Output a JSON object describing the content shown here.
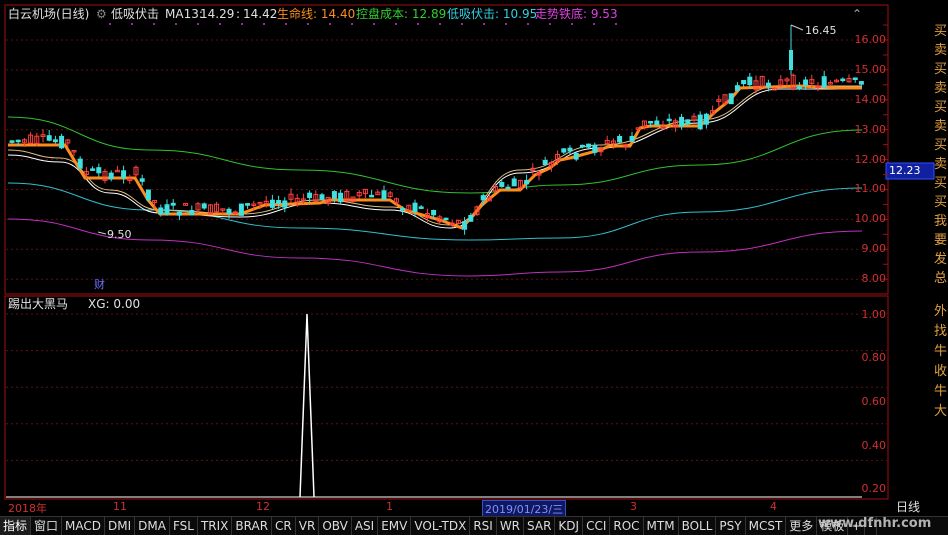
{
  "header": {
    "stock": "白云机场(日线)",
    "indicator_name": "低吸伏击",
    "ma13_label": "MA13:",
    "ma13_a": "14.29",
    "sep": ":",
    "ma13_b": "14.42",
    "life_line": "生命线: 14.40",
    "cost": "控盘成本: 12.89",
    "low_buy": "低吸伏击: 10.95",
    "trend_floor": "走势铁底: 9.53"
  },
  "main_chart": {
    "y_labels": [
      "16.00",
      "15.00",
      "14.00",
      "13.00",
      "12.00",
      "11.00",
      "10.00",
      "9.00",
      "8.00"
    ],
    "current_price": "12.23",
    "high_marker": "16.45",
    "low_marker": "9.50",
    "finance_marker": "财",
    "right_text": [
      "买",
      "卖",
      "买",
      "卖",
      "买",
      "卖",
      "买",
      "卖",
      "买",
      "买",
      "我",
      "要",
      "发",
      "总"
    ]
  },
  "sub_chart": {
    "title": "踢出大黑马",
    "xg": "XG: 0.00",
    "y_labels": [
      "1.00",
      "0.80",
      "0.60",
      "0.40",
      "0.20"
    ],
    "right_text": [
      "外",
      "找",
      "牛",
      "收",
      "牛",
      "大"
    ]
  },
  "date_axis": {
    "labels": [
      "2018年",
      "11",
      "12",
      "1",
      "2019/01/23/三",
      "3",
      "4"
    ]
  },
  "period": "日线",
  "tabs": [
    "指标",
    "窗口",
    "MACD",
    "DMI",
    "DMA",
    "FSL",
    "TRIX",
    "BRAR",
    "CR",
    "VR",
    "OBV",
    "ASI",
    "EMV",
    "VOL-TDX",
    "RSI",
    "WR",
    "SAR",
    "KDJ",
    "CCI",
    "ROC",
    "MTM",
    "BOLL",
    "PSY",
    "MCST",
    "更多",
    "模板",
    "+",
    "-"
  ],
  "watermark": "www.dfnhr.com",
  "colors": {
    "bg": "#000000",
    "axis": "#a01010",
    "up": "#ff4040",
    "down": "#40e0e0",
    "orange": "#ff8c1a",
    "green": "#30c030",
    "cyan": "#30c0d0",
    "magenta": "#c030c0"
  }
}
